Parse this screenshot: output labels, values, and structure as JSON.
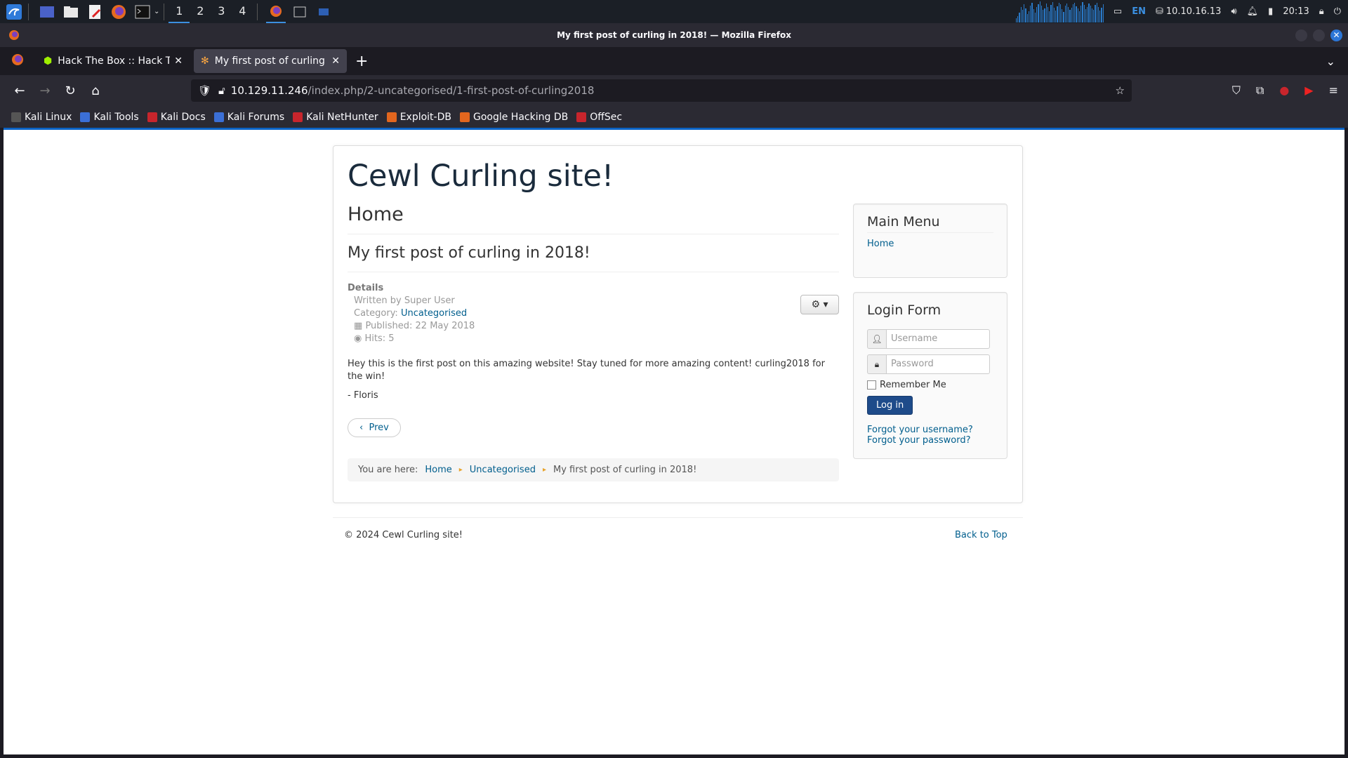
{
  "taskbar": {
    "workspaces": [
      "1",
      "2",
      "3",
      "4"
    ],
    "language": "EN",
    "ip": "10.10.16.13",
    "time": "20:13"
  },
  "window": {
    "title": "My first post of curling in 2018! — Mozilla Firefox"
  },
  "tabs": [
    {
      "label": "Hack The Box :: Hack The"
    },
    {
      "label": "My first post of curling in"
    }
  ],
  "url": {
    "host": "10.129.11.246",
    "path": "/index.php/2-uncategorised/1-first-post-of-curling2018"
  },
  "bookmarks": [
    {
      "label": "Kali Linux",
      "color": "#555555"
    },
    {
      "label": "Kali Tools",
      "color": "#3b6fd6"
    },
    {
      "label": "Kali Docs",
      "color": "#c8252c"
    },
    {
      "label": "Kali Forums",
      "color": "#3b6fd6"
    },
    {
      "label": "Kali NetHunter",
      "color": "#c8252c"
    },
    {
      "label": "Exploit-DB",
      "color": "#e2661e"
    },
    {
      "label": "Google Hacking DB",
      "color": "#e2661e"
    },
    {
      "label": "OffSec",
      "color": "#c8252c"
    }
  ],
  "page": {
    "site_title": "Cewl Curling site!",
    "page_header": "Home",
    "article_title": "My first post of curling in 2018!",
    "details_label": "Details",
    "written_by": "Written by Super User",
    "category_label": "Category:",
    "category_value": "Uncategorised",
    "published": "Published: 22 May 2018",
    "hits": "Hits: 5",
    "body_text": "Hey this is the first post on this amazing website! Stay tuned for more amazing content! curling2018 for the win!",
    "signature": "- Floris",
    "prev_label": "Prev",
    "breadcrumb_prefix": "You are here:",
    "breadcrumb_home": "Home",
    "breadcrumb_category": "Uncategorised",
    "breadcrumb_current": "My first post of curling in 2018!"
  },
  "sidebar": {
    "main_menu_title": "Main Menu",
    "main_menu_item": "Home",
    "login_title": "Login Form",
    "username_placeholder": "Username",
    "password_placeholder": "Password",
    "remember_label": "Remember Me",
    "login_button": "Log in",
    "forgot_username": "Forgot your username?",
    "forgot_password": "Forgot your password?"
  },
  "footer": {
    "copyright": "© 2024 Cewl Curling site!",
    "back_to_top": "Back to Top"
  }
}
